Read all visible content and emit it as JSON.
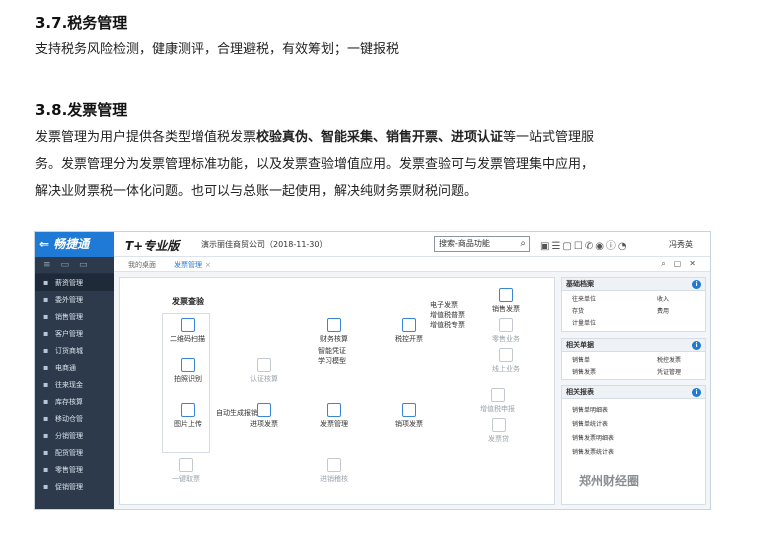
{
  "section37": {
    "title": "3.7.税务管理",
    "body": "支持税务风险检测，健康测评，合理避税，有效筹划；一键报税"
  },
  "section38": {
    "title": "3.8.发票管理",
    "line1_a": "发票管理为用户提供各类型增值税发票",
    "line1_b": "校验真伪、智能采集、销售开票、进项认证",
    "line1_c": "等一站式管理服",
    "line2": "务。发票管理分为发票管理标准功能，以及发票查验增值应用。发票查验可与发票管理集中应用，",
    "line3": "解决业财票税一体化问题。也可以与总账一起使用，解决纯财务票财税问题。"
  },
  "screenshot": {
    "brand": "⇐ 畅捷通",
    "product": "T+专业版",
    "company": "演示丽佳商贸公司（2018-11-30）",
    "search_placeholder": "搜索-商品功能",
    "username": "冯秀英",
    "sidebar": [
      "薪资管理",
      "委外管理",
      "销售管理",
      "客户管理",
      "订货商城",
      "电商通",
      "往来现金",
      "库存核算",
      "移动仓管",
      "分销管理",
      "配货管理",
      "零售管理",
      "促销管理"
    ],
    "tabs": {
      "desk": "我的桌面",
      "invoice": "发票管理"
    },
    "flow": {
      "check_title": "发票查验",
      "qr": "二维码扫描",
      "photo": "拍照识别",
      "upload": "图片上传",
      "auto": "自动生成报销",
      "finance": "财务核算",
      "smart": "智能凭证\n学习模型",
      "tax": "税控开票",
      "einvoice": "电子发票\n增值税普票\n增值税专票",
      "sales_inv": "销售发票",
      "retail": "零售业务",
      "online": "线上业务",
      "verify": "认证核算",
      "in_inv": "进项发票",
      "inv_mgmt": "发票管理",
      "out_inv": "销项发票",
      "vat": "增值税申报",
      "inv_loan": "发票贷",
      "one_key": "一键取票",
      "in_detail": "进销稽核"
    },
    "panels": {
      "basic": {
        "title": "基础档案",
        "items": [
          "往来单位",
          "收入",
          "存货",
          "费用",
          "计量单位"
        ]
      },
      "docs": {
        "title": "相关单据",
        "items": [
          "销售单",
          "税控发票",
          "销售发票",
          "凭证管理"
        ]
      },
      "reports": {
        "title": "相关报表",
        "items": [
          "销售单明细表",
          "销售单统计表",
          "销售发票明细表",
          "销售发票统计表"
        ]
      }
    },
    "watermark": "郑州财经圈"
  }
}
